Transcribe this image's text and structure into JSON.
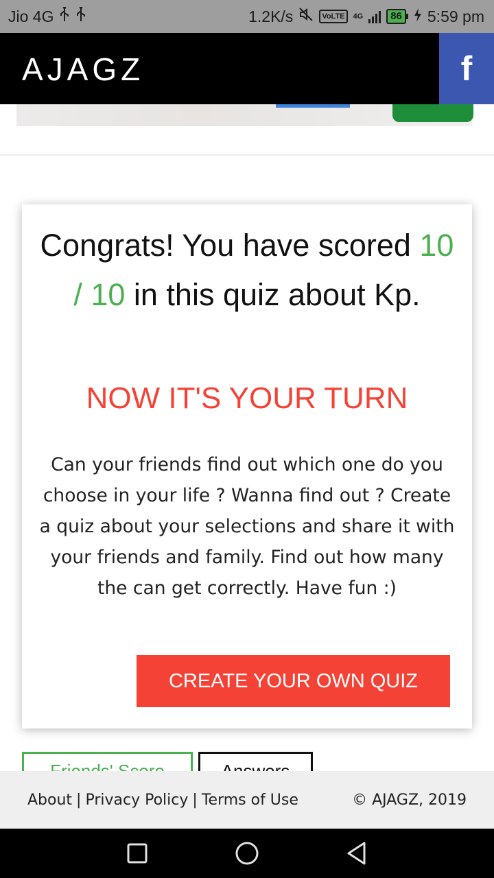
{
  "status_bar": {
    "carrier": "Jio 4G",
    "speed": "1.2K/s",
    "volte": "VoLTE",
    "network_type": "4G",
    "battery": "86",
    "time": "5:59 pm"
  },
  "header": {
    "brand": "AJAGZ",
    "facebook_label": "f"
  },
  "result": {
    "headline_prefix": "Congrats! You have scored ",
    "score": "10 / 10",
    "headline_suffix": " in this quiz about Kp.",
    "turn_title": "NOW IT'S YOUR TURN",
    "description": "Can your friends find out which one do you choose in your life ? Wanna find out ? Create a quiz about your selections and share it with your friends and family. Find out how many the can get correctly. Have fun :)",
    "create_button": "CREATE YOUR OWN QUIZ"
  },
  "tabs": {
    "friends_score": "Friends' Score",
    "answers": "Answers"
  },
  "footer": {
    "about": "About",
    "privacy": "Privacy Policy",
    "terms": "Terms of Use",
    "separator": "|",
    "copyright": "© AJAGZ, 2019"
  },
  "colors": {
    "brand_black": "#000000",
    "facebook_blue": "#3b57b0",
    "score_green": "#4caf50",
    "accent_red": "#f44336"
  },
  "icons": [
    "usb-icon",
    "mute-icon",
    "signal-icon",
    "battery-icon",
    "charging-icon",
    "recents-icon",
    "home-icon",
    "back-icon"
  ]
}
